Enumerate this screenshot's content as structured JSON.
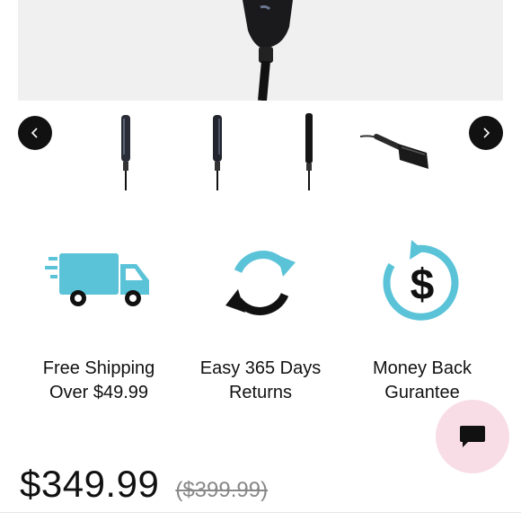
{
  "gallery": {
    "prev_icon": "chevron-left-icon",
    "next_icon": "chevron-right-icon",
    "thumbnails": [
      {
        "name": "straightener-front"
      },
      {
        "name": "straightener-side"
      },
      {
        "name": "straightener-back"
      },
      {
        "name": "straightener-angled"
      }
    ]
  },
  "features": [
    {
      "icon": "truck-icon",
      "line1": "Free Shipping",
      "line2": "Over $49.99"
    },
    {
      "icon": "refresh-icon",
      "line1": "Easy 365 Days",
      "line2": "Returns"
    },
    {
      "icon": "money-back-icon",
      "line1": "Money Back",
      "line2": "Gurantee"
    }
  ],
  "pricing": {
    "price": "$349.99",
    "original_price": "($399.99)"
  },
  "chat": {
    "icon": "chat-icon"
  },
  "colors": {
    "accent": "#5bc3d8",
    "chat_bg": "#f8dde6",
    "dark": "#111111"
  }
}
